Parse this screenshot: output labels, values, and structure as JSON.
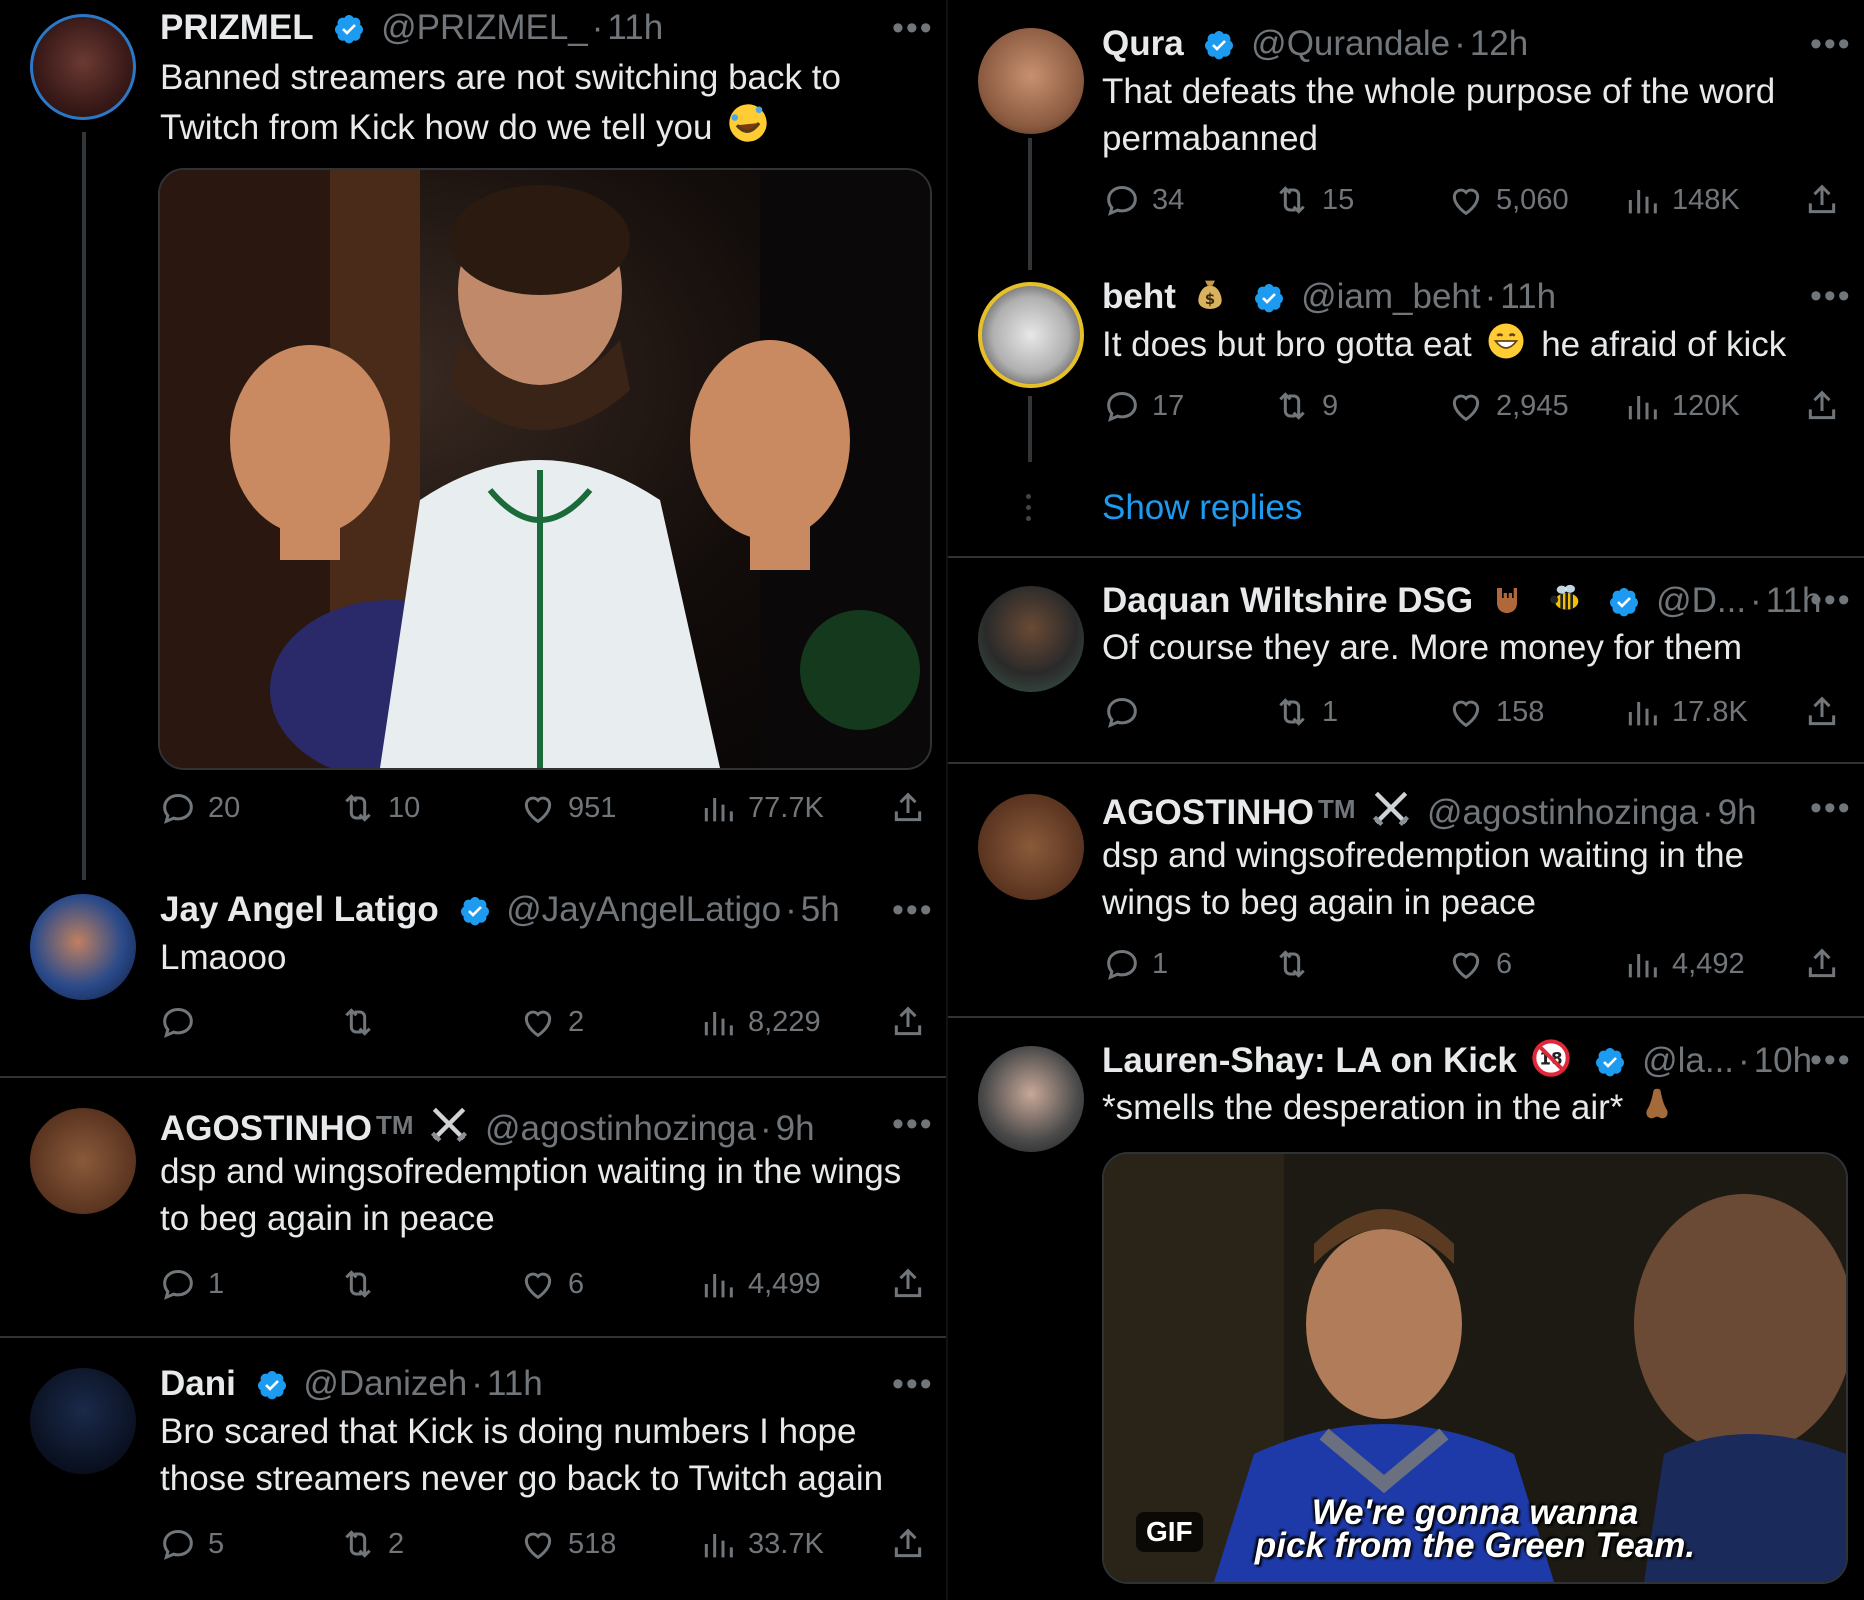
{
  "left": {
    "t1": {
      "name": "PRIZMEL",
      "handle": "@PRIZMEL_",
      "time": "11h",
      "text": "Banned streamers are not switching back to Twitch from Kick how do we tell you",
      "replies": "20",
      "reposts": "10",
      "likes": "951",
      "views": "77.7K"
    },
    "t2": {
      "name": "Jay Angel Latigo",
      "handle": "@JayAngelLatigo",
      "time": "5h",
      "text": "Lmaooo",
      "replies": "",
      "reposts": "",
      "likes": "2",
      "views": "8,229"
    },
    "t3": {
      "name": "AGOSTINHO",
      "tm": "TM",
      "handle": "@agostinhozinga",
      "time": "9h",
      "text": "dsp and wingsofredemption waiting in the wings to beg again in peace",
      "replies": "1",
      "reposts": "",
      "likes": "6",
      "views": "4,499"
    },
    "t4": {
      "name": "Dani",
      "handle": "@Danizeh",
      "time": "11h",
      "text": "Bro scared that Kick is doing numbers I hope those streamers never go back to Twitch again",
      "replies": "5",
      "reposts": "2",
      "likes": "518",
      "views": "33.7K"
    }
  },
  "right": {
    "t1": {
      "name": "Qura",
      "handle": "@Qurandale",
      "time": "12h",
      "text": "That defeats the whole purpose of the word permabanned",
      "replies": "34",
      "reposts": "15",
      "likes": "5,060",
      "views": "148K"
    },
    "t2": {
      "name": "beht",
      "handle": "@iam_beht",
      "time": "11h",
      "text_a": "It does but bro gotta eat",
      "text_b": "he afraid of kick",
      "replies": "17",
      "reposts": "9",
      "likes": "2,945",
      "views": "120K"
    },
    "show_replies": "Show replies",
    "t3": {
      "name": "Daquan Wiltshire DSG",
      "handle": "@D...",
      "time": "11h",
      "text": "Of course they are. More money for them",
      "replies": "",
      "reposts": "1",
      "likes": "158",
      "views": "17.8K"
    },
    "t4": {
      "name": "AGOSTINHO",
      "tm": "TM",
      "handle": "@agostinhozinga",
      "time": "9h",
      "text": "dsp and wingsofredemption waiting in the wings to beg again in peace",
      "replies": "1",
      "reposts": "",
      "likes": "6",
      "views": "4,492"
    },
    "t5": {
      "name": "Lauren-Shay: LA on Kick",
      "handle": "@la...",
      "time": "10h",
      "text": "*smells the desperation in the air*",
      "gif_badge": "GIF",
      "gif_caption_1": "We're gonna wanna",
      "gif_caption_2": "pick from the Green Team."
    }
  },
  "colors": {
    "background": "#000000",
    "text": "#e7e9ea",
    "muted": "#71767b",
    "accent": "#1d9bf0",
    "verified": "#1d9bf0",
    "divider": "#2f3336"
  },
  "icons": [
    "verified-badge-icon",
    "reply-icon",
    "repost-icon",
    "like-icon",
    "views-icon",
    "share-icon",
    "more-icon"
  ]
}
